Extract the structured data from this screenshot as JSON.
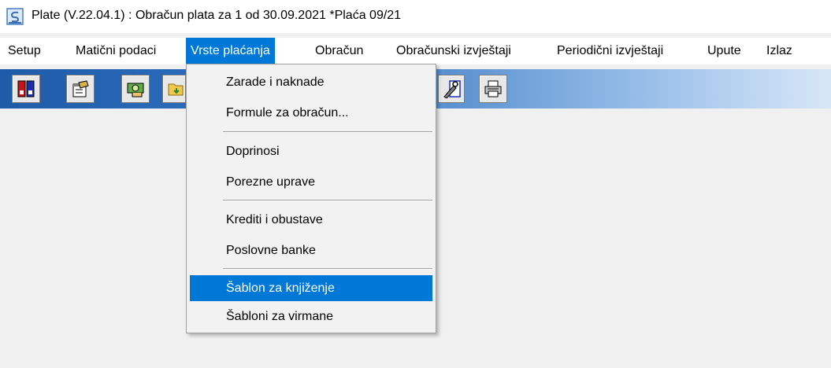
{
  "window": {
    "title": "Plate (V.22.04.1) : Obračun plata za 1 od 30.09.2021 *Plaća 09/21"
  },
  "menubar": {
    "items": [
      {
        "label": "Setup"
      },
      {
        "label": "Matični podaci"
      },
      {
        "label": "Vrste plaćanja",
        "active": true
      },
      {
        "label": "Obračun"
      },
      {
        "label": "Obračunski izvještaji"
      },
      {
        "label": "Periodični izvještaji"
      },
      {
        "label": "Upute"
      },
      {
        "label": "Izlaz"
      }
    ]
  },
  "toolbar": {
    "buttons": [
      {
        "icon": "binders-icon"
      },
      {
        "icon": "properties-icon"
      },
      {
        "icon": "money-icon"
      },
      {
        "icon": "folder-import-icon"
      },
      {
        "icon": "tools-icon"
      },
      {
        "icon": "printer-icon"
      }
    ]
  },
  "dropdown": {
    "items": [
      {
        "label": "Zarade i naknade"
      },
      {
        "label": "Formule za obračun..."
      },
      {
        "label": "Doprinosi"
      },
      {
        "label": "Porezne uprave"
      },
      {
        "label": "Krediti i obustave"
      },
      {
        "label": "Poslovne banke"
      },
      {
        "label": "Šablon za knjiženje",
        "highlighted": true
      },
      {
        "label": "Šabloni za virmane"
      }
    ]
  },
  "colors": {
    "highlight": "#0078d7",
    "toolbar_start": "#1e5ba8",
    "toolbar_end": "#d8e7f7"
  }
}
